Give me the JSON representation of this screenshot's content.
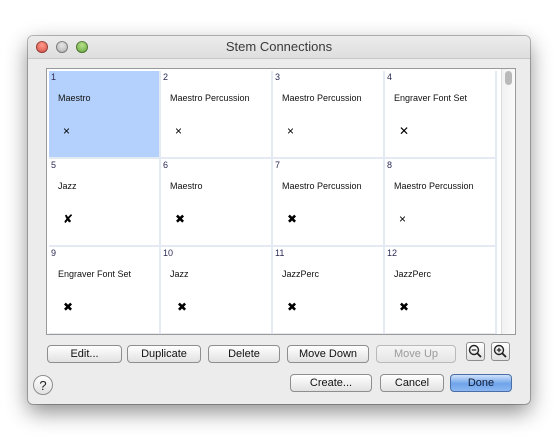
{
  "window": {
    "title": "Stem Connections"
  },
  "cells": [
    {
      "number": "1",
      "label": "Maestro",
      "glyph": "×",
      "selected": true
    },
    {
      "number": "2",
      "label": "Maestro Percussion",
      "glyph": "×"
    },
    {
      "number": "3",
      "label": "Maestro Percussion",
      "glyph": "×"
    },
    {
      "number": "4",
      "label": "Engraver Font Set",
      "glyph": "✕"
    },
    {
      "number": "5",
      "label": "Jazz",
      "glyph": "✘"
    },
    {
      "number": "6",
      "label": "Maestro",
      "glyph": "✖"
    },
    {
      "number": "7",
      "label": "Maestro Percussion",
      "glyph": "✖"
    },
    {
      "number": "8",
      "label": "Maestro Percussion",
      "glyph": "×"
    },
    {
      "number": "9",
      "label": "Engraver Font Set",
      "glyph": "✖"
    },
    {
      "number": "10",
      "label": "Jazz",
      "glyph": "✖"
    },
    {
      "number": "11",
      "label": "JazzPerc",
      "glyph": "✖"
    },
    {
      "number": "12",
      "label": "JazzPerc",
      "glyph": "✖"
    }
  ],
  "toolbar": {
    "edit": "Edit...",
    "duplicate": "Duplicate",
    "delete": "Delete",
    "move_down": "Move Down",
    "move_up": "Move Up"
  },
  "footer": {
    "help": "?",
    "create": "Create...",
    "cancel": "Cancel",
    "done": "Done"
  }
}
